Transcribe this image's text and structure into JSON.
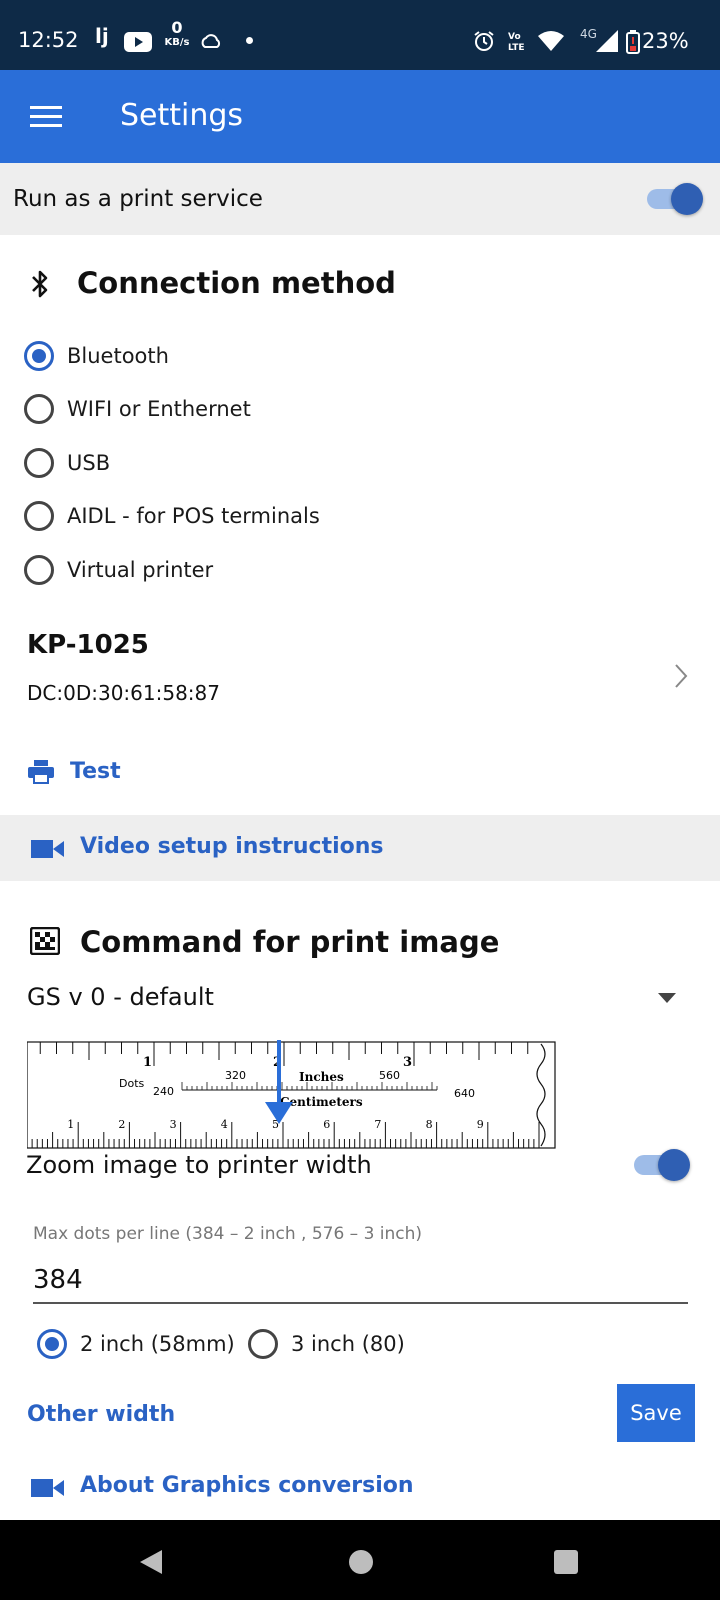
{
  "status_bar": {
    "time": "12:52",
    "net_speed_value": "0",
    "net_speed_unit": "KB/s",
    "network": "4G",
    "battery": "23%"
  },
  "app_bar": {
    "title": "Settings"
  },
  "print_service": {
    "label": "Run as a print service",
    "enabled": true
  },
  "connection": {
    "title": "Connection method",
    "options": [
      {
        "label": "Bluetooth",
        "selected": true
      },
      {
        "label": "WIFI or Enthernet",
        "selected": false
      },
      {
        "label": "USB",
        "selected": false
      },
      {
        "label": "AIDL - for POS terminals",
        "selected": false
      },
      {
        "label": "Virtual printer",
        "selected": false
      }
    ],
    "device_name": "KP-1025",
    "device_address": "DC:0D:30:61:58:87",
    "test_label": "Test",
    "video_label": "Video setup instructions"
  },
  "print_image": {
    "title": "Command for print image",
    "selected_command": "GS v 0 - default",
    "ruler": {
      "dots_label": "Dots",
      "inches_label": "Inches",
      "cm_label": "Centimeters",
      "dots_values": [
        "240",
        "320",
        "560",
        "640"
      ],
      "inch_values": [
        "1",
        "2",
        "3"
      ],
      "cm_values": [
        "1",
        "2",
        "3",
        "4",
        "5",
        "6",
        "7",
        "8",
        "9"
      ]
    },
    "zoom_label": "Zoom image to printer width",
    "zoom_enabled": true,
    "max_dots_label": "Max dots per line (384 – 2 inch , 576 – 3 inch)",
    "max_dots_value": "384",
    "width_options": [
      {
        "label": "2 inch (58mm)",
        "selected": true
      },
      {
        "label": "3 inch (80)",
        "selected": false
      }
    ],
    "other_width_label": "Other width",
    "save_label": "Save",
    "about_label": "About Graphics conversion"
  },
  "colors": {
    "status_bar": "#0e2a47",
    "app_bar": "#2a6ed8",
    "accent": "#2a62c4"
  }
}
